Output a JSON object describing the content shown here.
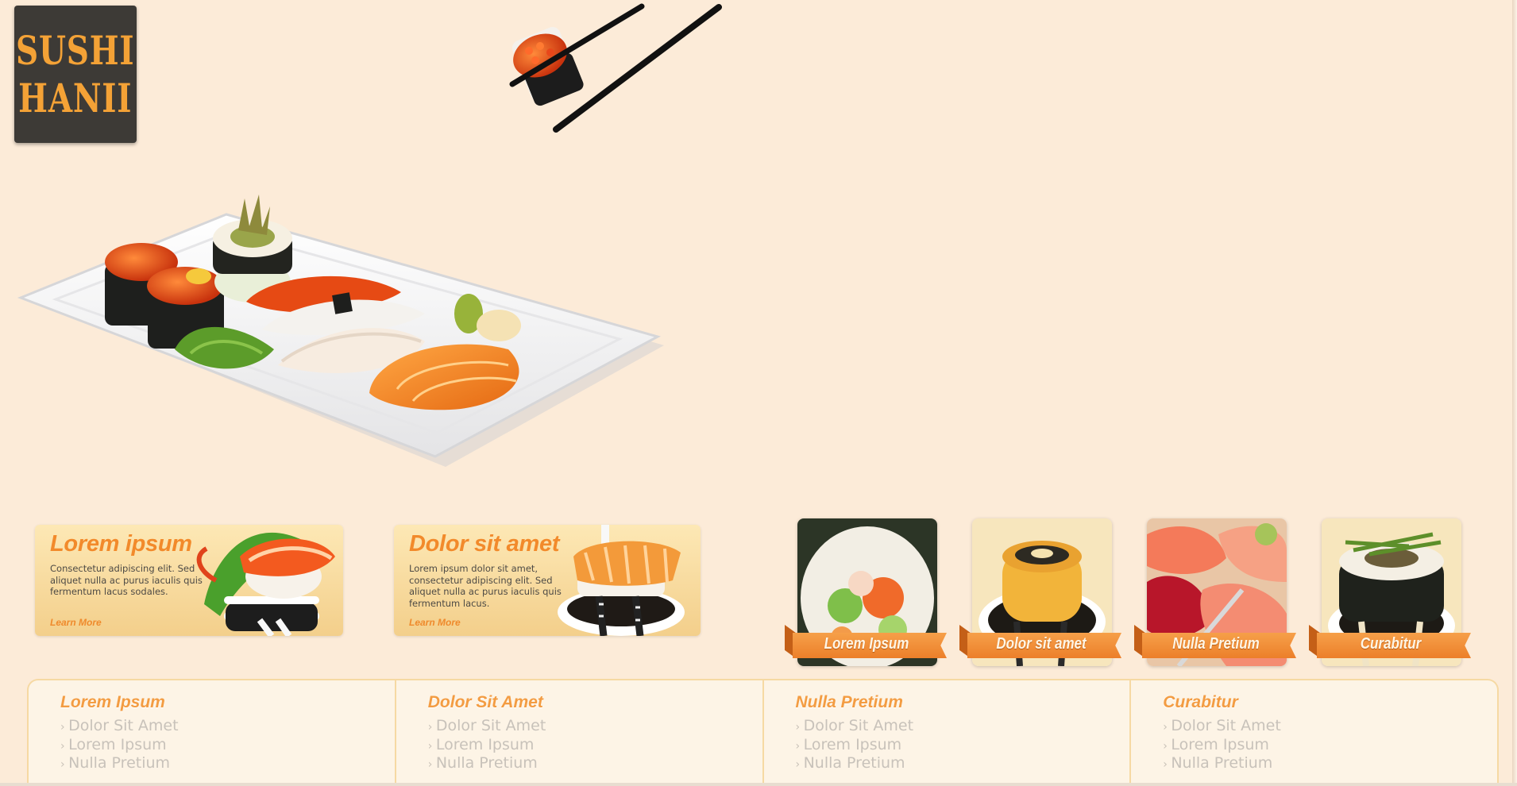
{
  "brand": {
    "line1": "SUSHI",
    "line2": "HANII"
  },
  "promos": [
    {
      "title": "Lorem ipsum",
      "desc": "Consectetur adipiscing elit. Sed aliquet nulla ac purus iaculis quis fermentum lacus sodales.",
      "link": "Learn More"
    },
    {
      "title": "Dolor sit amet",
      "desc": "Lorem ipsum dolor sit amet, consectetur adipiscing elit. Sed aliquet nulla ac purus iaculis quis fermentum lacus.",
      "link": "Learn More"
    }
  ],
  "tiles": [
    {
      "label": "Lorem Ipsum"
    },
    {
      "label": "Dolor sit amet"
    },
    {
      "label": "Nulla Pretium"
    },
    {
      "label": "Curabitur"
    }
  ],
  "footer": [
    {
      "heading": "Lorem Ipsum",
      "links": [
        "Dolor Sit Amet",
        "Lorem Ipsum",
        "Nulla Pretium"
      ]
    },
    {
      "heading": "Dolor Sit Amet",
      "links": [
        "Dolor Sit Amet",
        "Lorem Ipsum",
        "Nulla Pretium"
      ]
    },
    {
      "heading": "Nulla Pretium",
      "links": [
        "Dolor Sit Amet",
        "Lorem Ipsum",
        "Nulla Pretium"
      ]
    },
    {
      "heading": "Curabitur",
      "links": [
        "Dolor Sit Amet",
        "Lorem Ipsum",
        "Nulla Pretium"
      ]
    }
  ],
  "colors": {
    "accent": "#f28a2b",
    "background": "#fcebd8",
    "logo_bg": "#3d3a36",
    "logo_text": "#f4a236"
  }
}
